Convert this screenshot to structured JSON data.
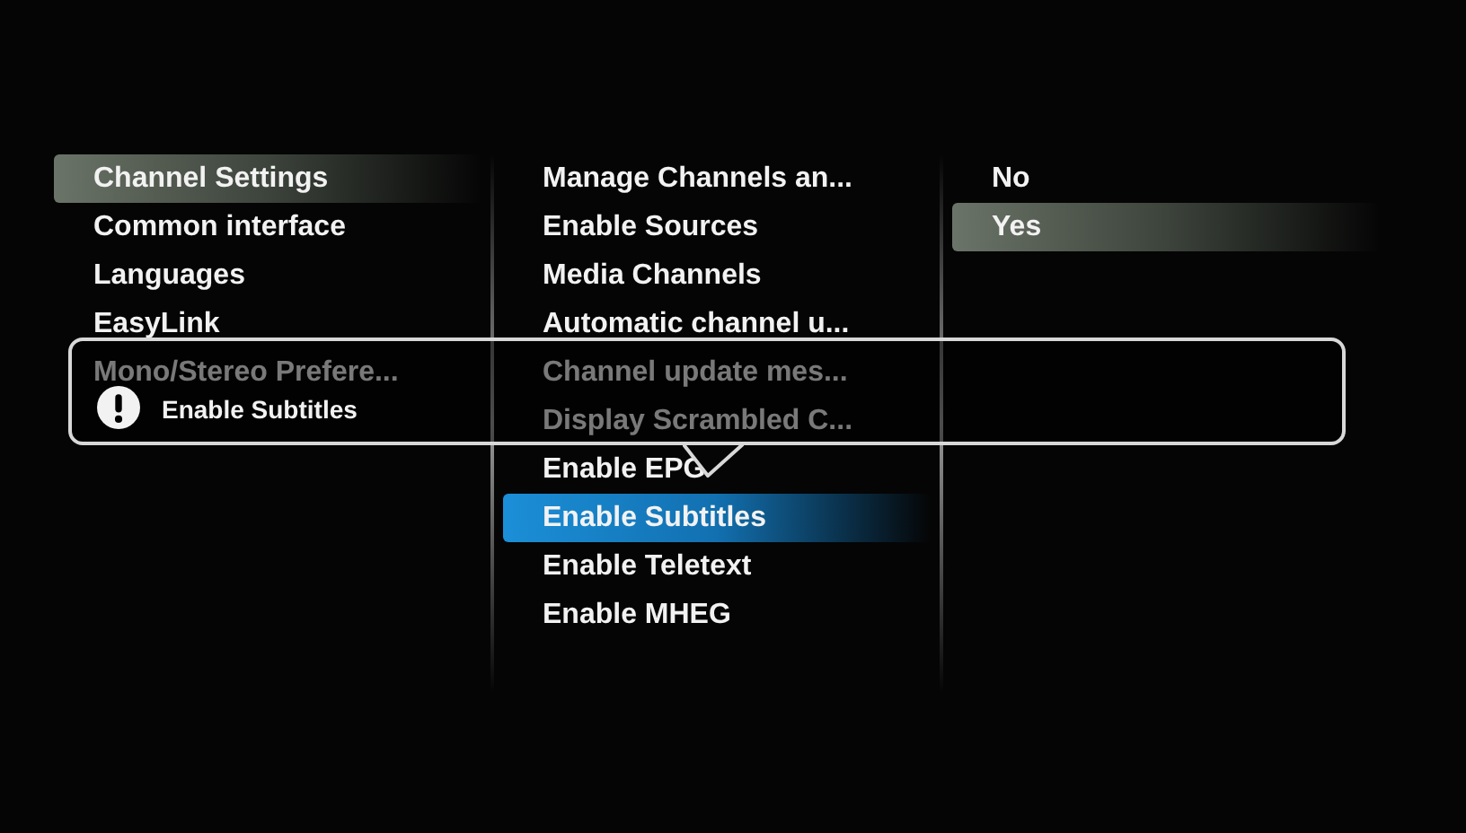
{
  "columns": [
    {
      "focused": false,
      "items": [
        {
          "label": "Channel Settings",
          "selected": true
        },
        {
          "label": "Common interface",
          "selected": false
        },
        {
          "label": "Languages",
          "selected": false
        },
        {
          "label": "EasyLink",
          "selected": false
        },
        {
          "label": "Mono/Stereo Prefere...",
          "selected": false
        }
      ]
    },
    {
      "focused": true,
      "items": [
        {
          "label": "Manage Channels an...",
          "selected": false
        },
        {
          "label": "Enable Sources",
          "selected": false
        },
        {
          "label": "Media Channels",
          "selected": false
        },
        {
          "label": "Automatic channel u...",
          "selected": false
        },
        {
          "label": "Channel update mes...",
          "selected": false
        },
        {
          "label": "Display Scrambled C...",
          "selected": false
        },
        {
          "label": "Enable EPG",
          "selected": false
        },
        {
          "label": "Enable Subtitles",
          "selected": true
        },
        {
          "label": "Enable Teletext",
          "selected": false
        },
        {
          "label": "Enable MHEG",
          "selected": false
        }
      ]
    },
    {
      "focused": false,
      "items": [
        {
          "label": "No",
          "selected": false
        },
        {
          "label": "Yes",
          "selected": true
        }
      ]
    }
  ],
  "tooltip": {
    "text": "Enable Subtitles"
  }
}
